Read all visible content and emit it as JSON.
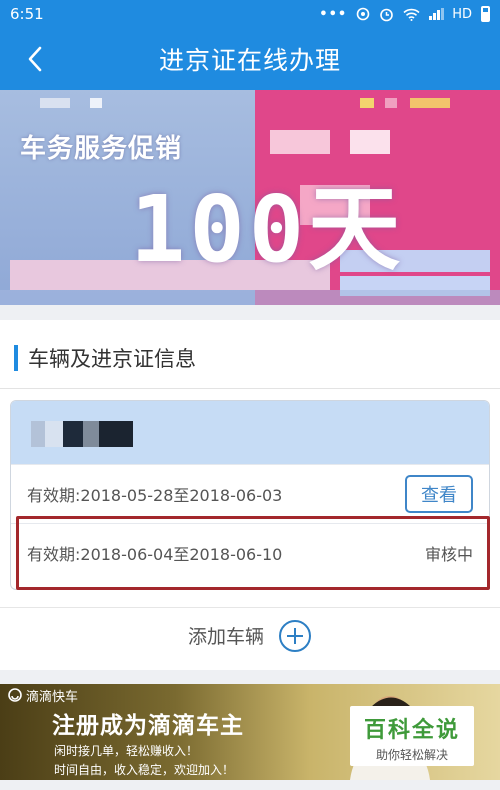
{
  "status_bar": {
    "time": "6:51",
    "network": "HD"
  },
  "header": {
    "title": "进京证在线办理",
    "back_icon": "chevron-left-icon"
  },
  "banner": {
    "headline": "车务服务促销",
    "big_text": "100天"
  },
  "section": {
    "title": "车辆及进京证信息"
  },
  "permits": [
    {
      "label": "有效期:2018-05-28至2018-06-03",
      "action": "查看"
    },
    {
      "label": "有效期:2018-06-04至2018-06-10",
      "status": "审核中"
    }
  ],
  "add_vehicle": {
    "label": "添加车辆",
    "icon": "plus-circle-icon"
  },
  "ad": {
    "brand": "滴滴快车",
    "headline": "注册成为滴滴车主",
    "line1": "闲时接几单，轻松赚收入！",
    "line2": "时间自由，收入稳定，欢迎加入！"
  },
  "watermark": {
    "title": "百科全说",
    "subtitle": "助你轻松解决"
  },
  "colors": {
    "primary": "#1f8be0",
    "highlight_box": "#a3282c",
    "card_header": "#c6dcf5"
  }
}
